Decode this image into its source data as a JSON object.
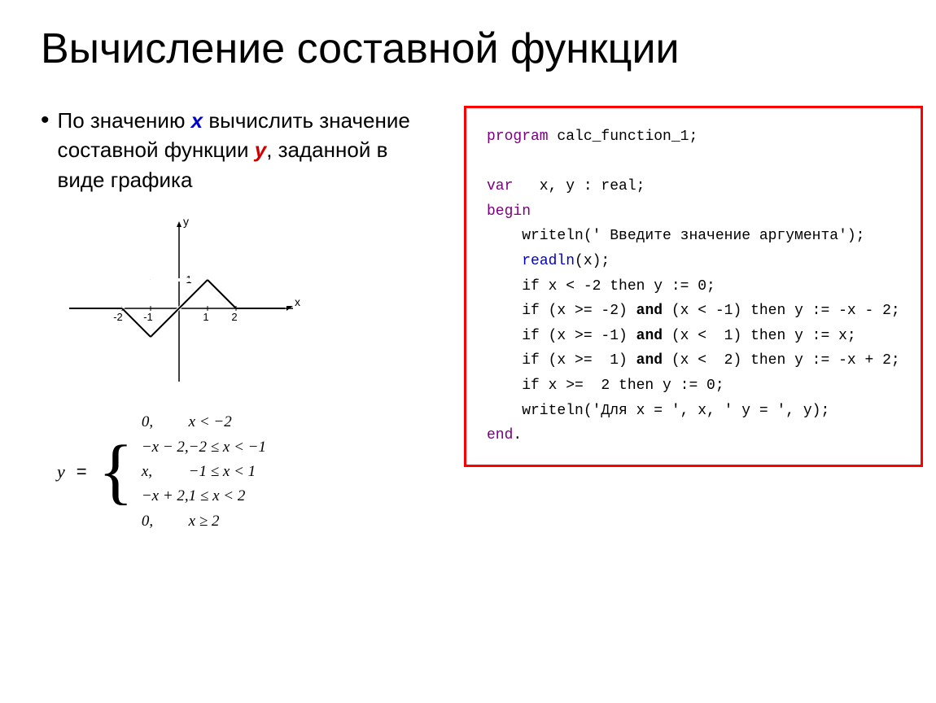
{
  "title": "Вычисление составной функции",
  "bullet": {
    "prefix": "По значению ",
    "x_var": "x",
    "middle": " вычислить значение составной функции ",
    "y_var": "y",
    "suffix": ", заданной в виде графика"
  },
  "code": {
    "line1": "program calc_function_1;",
    "line2": "",
    "line3_kw": "var",
    "line3_rest": "  x, y : real;",
    "line4_kw": "begin",
    "lines": [
      "    writeln(' Введите значение аргумента');",
      "    readln(x);",
      "    if x < -2 then y := 0;",
      "    if (x >= -2) and (x < -1) then y := -x - 2;",
      "    if (x >= -1) and (x <  1) then y := x;",
      "    if (x >=  1) and (x <  2) then y := -x + 2;",
      "    if x >=  2 then y := 0;",
      "    writeln('Для x = ', x, ' y = ', y);"
    ],
    "line_end": "end."
  },
  "formula": {
    "cases": [
      {
        "expr": "0,",
        "cond": "x < −2"
      },
      {
        "expr": "−x − 2,",
        "cond": "−2 ≤ x < −1"
      },
      {
        "expr": "x,",
        "cond": "−1 ≤ x < 1"
      },
      {
        "expr": "−x + 2,",
        "cond": "1 ≤ x < 2"
      },
      {
        "expr": "0,",
        "cond": "x ≥ 2"
      }
    ]
  }
}
